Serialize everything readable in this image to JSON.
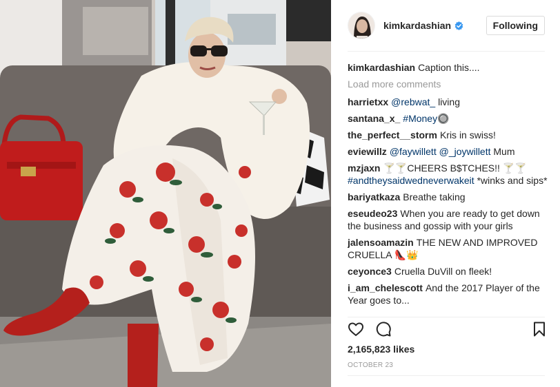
{
  "header": {
    "username": "kimkardashian",
    "follow_label": "Following"
  },
  "comments_panel": {
    "caption": {
      "user": "kimkardashian",
      "text": "Caption this...."
    },
    "load_more": "Load more comments",
    "comments": [
      {
        "user": "harrietxx",
        "mention": "@rebwat_",
        "text": " living"
      },
      {
        "user": "santana_x_",
        "mention": "#Money",
        "text": "🔘"
      },
      {
        "user": "the_perfect__storm",
        "mention": "",
        "text": "Kris in swiss!"
      },
      {
        "user": "eviewillz",
        "mention": "@faywillett @_joywillett",
        "text": " Mum"
      },
      {
        "user": "mzjaxn",
        "text_pre": "🍸🍸CHEERS B$TCHES!! 🍸🍸 ",
        "mention": "#andtheysaidwedneverwakeit",
        "text": " *winks and sips*"
      },
      {
        "user": "bariyatkaza",
        "mention": "",
        "text": "Breathe taking"
      },
      {
        "user": "eseudeo23",
        "mention": "",
        "text": "When you are ready to get down the business and gossip with your girls"
      },
      {
        "user": "jalensoamazin",
        "mention": "",
        "text": "THE NEW AND IMPROVED CRUELLA 👠👑"
      },
      {
        "user": "ceyonce3",
        "mention": "",
        "text": "Cruella DuVill on fleek!"
      },
      {
        "user": "i_am_chelescott",
        "mention": "",
        "text": "And the 2017 Player of the Year goes to..."
      }
    ]
  },
  "footer": {
    "likes": "2,165,823 likes",
    "date": "OCTOBER 23"
  },
  "icons": {
    "like": "heart-icon",
    "comment": "comment-icon",
    "save": "bookmark-icon",
    "verified": "verified-badge-icon"
  },
  "colors": {
    "link": "#003569",
    "verified": "#3897f0",
    "muted": "#999999",
    "text": "#262626"
  }
}
